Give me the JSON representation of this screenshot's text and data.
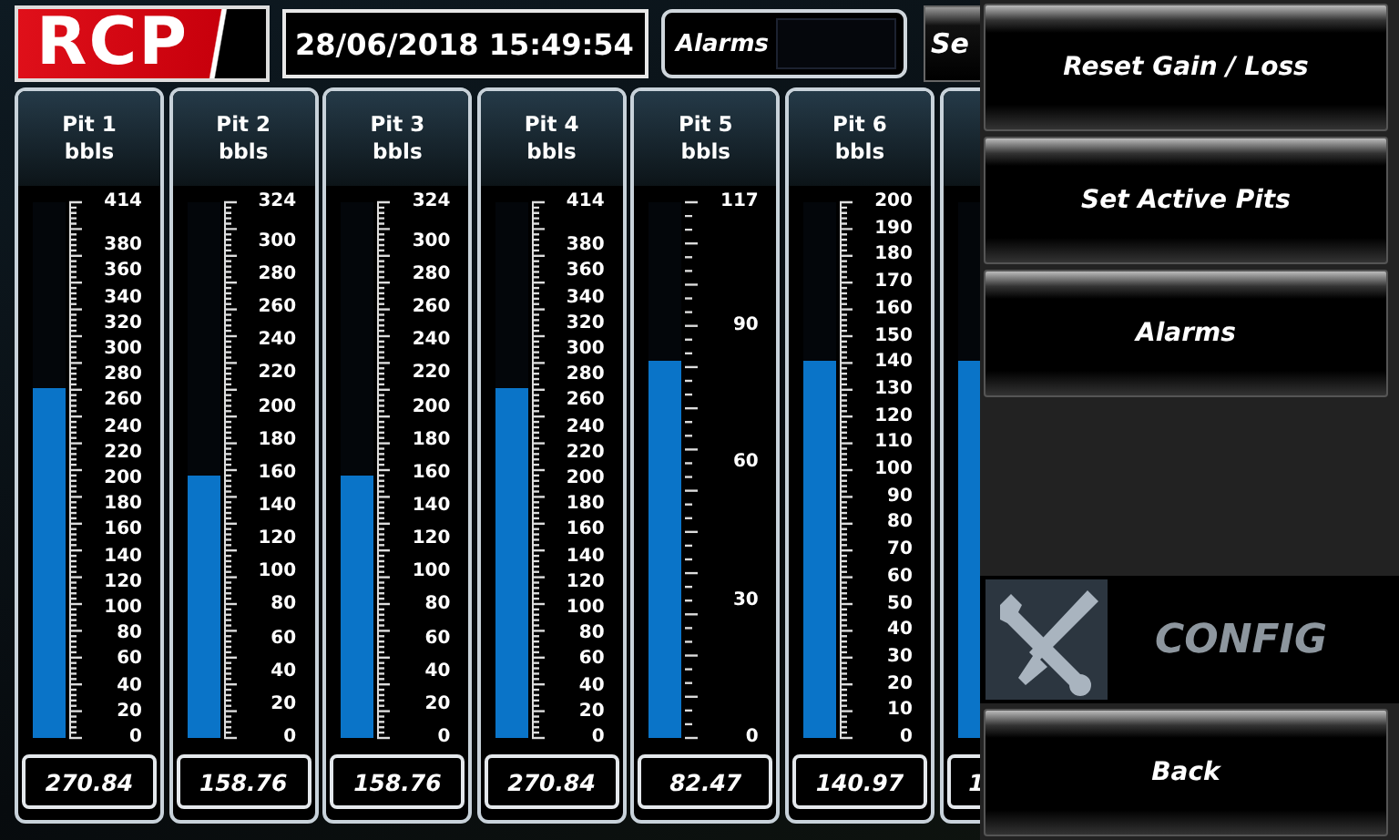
{
  "header": {
    "logo": "RCP",
    "datetime": "28/06/2018 15:49:54",
    "alarms_label": "Alarms",
    "cut_button": "Se"
  },
  "pits": [
    {
      "title": "Pit 1",
      "unit": "bbls",
      "labels": [
        "414",
        "380",
        "360",
        "340",
        "320",
        "300",
        "280",
        "260",
        "240",
        "220",
        "200",
        "180",
        "160",
        "140",
        "120",
        "100",
        "80",
        "60",
        "40",
        "20",
        "0"
      ],
      "level": 0.654,
      "value": "270.84"
    },
    {
      "title": "Pit 2",
      "unit": "bbls",
      "labels": [
        "324",
        "300",
        "280",
        "260",
        "240",
        "220",
        "200",
        "180",
        "160",
        "140",
        "120",
        "100",
        "80",
        "60",
        "40",
        "20",
        "0"
      ],
      "level": 0.49,
      "value": "158.76"
    },
    {
      "title": "Pit 3",
      "unit": "bbls",
      "labels": [
        "324",
        "300",
        "280",
        "260",
        "240",
        "220",
        "200",
        "180",
        "160",
        "140",
        "120",
        "100",
        "80",
        "60",
        "40",
        "20",
        "0"
      ],
      "level": 0.49,
      "value": "158.76"
    },
    {
      "title": "Pit 4",
      "unit": "bbls",
      "labels": [
        "414",
        "380",
        "360",
        "340",
        "320",
        "300",
        "280",
        "260",
        "240",
        "220",
        "200",
        "180",
        "160",
        "140",
        "120",
        "100",
        "80",
        "60",
        "40",
        "20",
        "0"
      ],
      "level": 0.654,
      "value": "270.84"
    },
    {
      "title": "Pit 5",
      "unit": "bbls",
      "labels": [
        "117",
        "90",
        "60",
        "30",
        "0"
      ],
      "level": 0.705,
      "value": "82.47"
    },
    {
      "title": "Pit 6",
      "unit": "bbls",
      "labels": [
        "200",
        "190",
        "180",
        "170",
        "160",
        "150",
        "140",
        "130",
        "120",
        "110",
        "100",
        "90",
        "80",
        "70",
        "60",
        "50",
        "40",
        "30",
        "20",
        "10",
        "0"
      ],
      "level": 0.705,
      "value": "140.97"
    },
    {
      "level": 0.705,
      "value": "1"
    }
  ],
  "menu": {
    "buttons": [
      "Reset Gain / Loss",
      "Set Active Pits",
      "Alarms"
    ],
    "section_title": "CONFIG",
    "back": "Back"
  }
}
